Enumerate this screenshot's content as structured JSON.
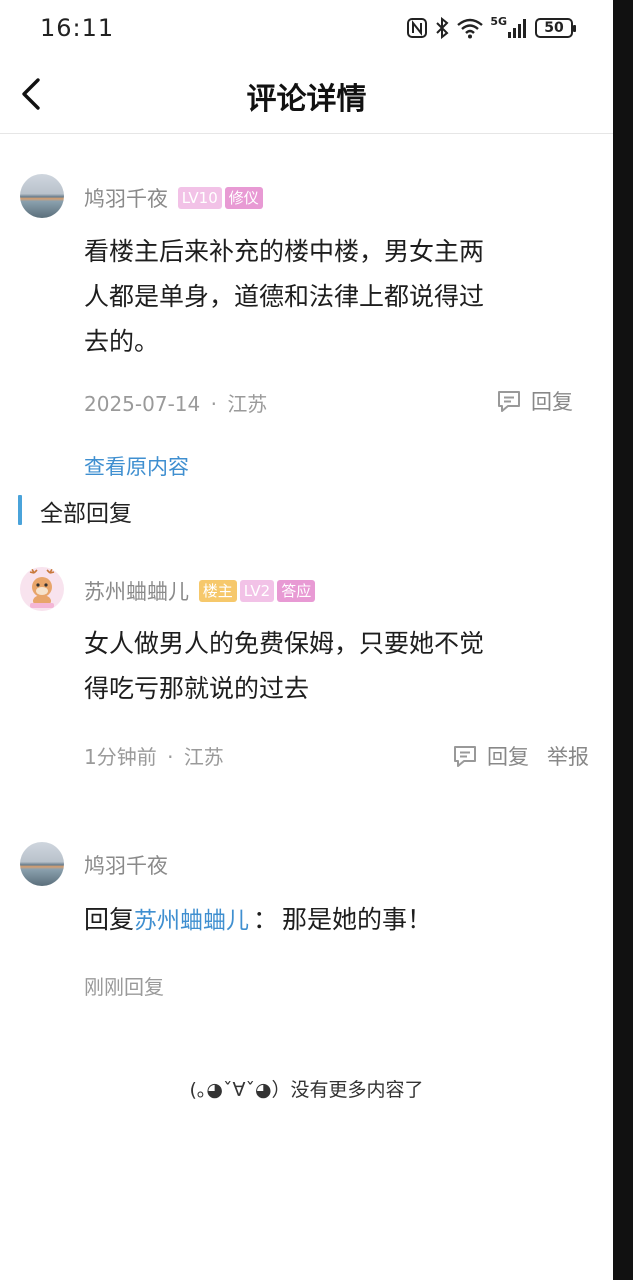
{
  "status_bar": {
    "time": "16:11",
    "icons": [
      "nfc-icon",
      "bluetooth-icon",
      "wifi-icon",
      "signal-5g-icon"
    ],
    "network": "5G",
    "battery": "50"
  },
  "nav": {
    "back_icon": "chevron-left-icon",
    "title": "评论详情"
  },
  "main_comment": {
    "author": "鸠羽千夜",
    "badges": [
      "LV10",
      "修仪"
    ],
    "content": "看楼主后来补充的楼中楼，男女主两人都是单身，道德和法律上都说得过去的。",
    "lines": [
      "看楼主后来补充的楼中楼，男女主两",
      "人都是单身，道德和法律上都说得过",
      "去的。"
    ],
    "date": "2025-07-14",
    "separator": "·",
    "location": "江苏",
    "reply_label": "回复",
    "view_original": "查看原内容"
  },
  "section_title": "全部回复",
  "replies": [
    {
      "author": "苏州蛐蛐儿",
      "badges": [
        "楼主",
        "LV2",
        "答应"
      ],
      "lines": [
        "女人做男人的免费保姆，只要她不觉",
        "得吃亏那就说的过去"
      ],
      "time": "1分钟前",
      "separator": "·",
      "location": "江苏",
      "reply_label": "回复",
      "report_label": "举报"
    },
    {
      "author": "鸠羽千夜",
      "reply_prefix": "回复",
      "reply_to": "苏州蛐蛐儿",
      "colon": "：",
      "content": "那是她的事！",
      "time": "刚刚回复"
    }
  ],
  "footer": {
    "no_more": "(｡◕ˇ∀ˇ◕）没有更多内容了"
  },
  "colors": {
    "accent_blue": "#3f8fd0",
    "section_bar": "#4aa3da",
    "badge_lv": "#f2c2e7",
    "badge_title": "#e89ad4",
    "badge_owner": "#f6c86b"
  }
}
